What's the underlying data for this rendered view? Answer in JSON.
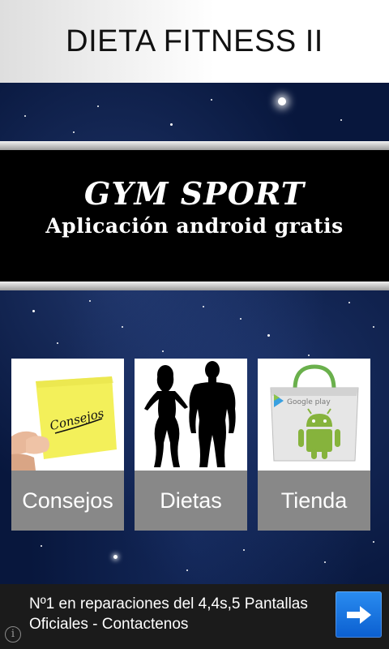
{
  "app": {
    "title": "DIETA FITNESS II"
  },
  "banner": {
    "line1": "GYM SPORT",
    "line2": "Aplicación android gratis"
  },
  "tiles": [
    {
      "label": "Consejos",
      "art_text": "Consejos",
      "icon": "sticky-note-hand-icon"
    },
    {
      "label": "Dietas",
      "icon": "fitness-silhouettes-icon"
    },
    {
      "label": "Tienda",
      "art_text": "Google play",
      "icon": "google-play-bag-icon"
    }
  ],
  "ad": {
    "text": "Nº1 en reparaciones del 4,4s,5 Pantallas Oficiales - Contactenos",
    "info_symbol": "i",
    "action_icon": "arrow-right-icon"
  },
  "colors": {
    "title_bar": "#ffffff",
    "sky": "#08173d",
    "banner_bg": "#000000",
    "tile_caption": "#787878",
    "ad_bg": "#1b1b1b",
    "ad_button": "#1a75e0"
  }
}
